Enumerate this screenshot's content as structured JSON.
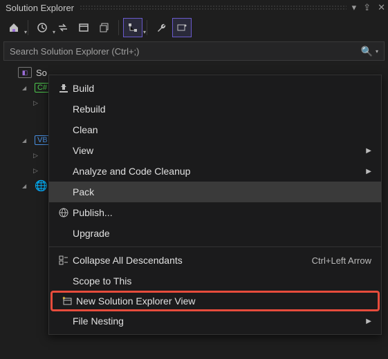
{
  "panel": {
    "title": "Solution Explorer"
  },
  "search": {
    "placeholder": "Search Solution Explorer (Ctrl+;)"
  },
  "tree": {
    "solution_prefix": "So",
    "cs_badge": "C#",
    "vb_badge": "VB"
  },
  "menu": {
    "items": [
      {
        "key": "build",
        "label": "Build",
        "icon": "build"
      },
      {
        "key": "rebuild",
        "label": "Rebuild"
      },
      {
        "key": "clean",
        "label": "Clean"
      },
      {
        "key": "view",
        "label": "View",
        "submenu": true
      },
      {
        "key": "analyze",
        "label": "Analyze and Code Cleanup",
        "submenu": true
      },
      {
        "key": "pack",
        "label": "Pack",
        "hover": true
      },
      {
        "key": "publish",
        "label": "Publish...",
        "icon": "publish"
      },
      {
        "key": "upgrade",
        "label": "Upgrade"
      },
      {
        "sep": true
      },
      {
        "key": "collapse",
        "label": "Collapse All Descendants",
        "icon": "collapse",
        "shortcut": "Ctrl+Left Arrow"
      },
      {
        "key": "scope",
        "label": "Scope to This"
      },
      {
        "key": "newview",
        "label": "New Solution Explorer View",
        "icon": "newview",
        "highlight": true
      },
      {
        "key": "filenesting",
        "label": "File Nesting",
        "submenu": true
      }
    ]
  }
}
